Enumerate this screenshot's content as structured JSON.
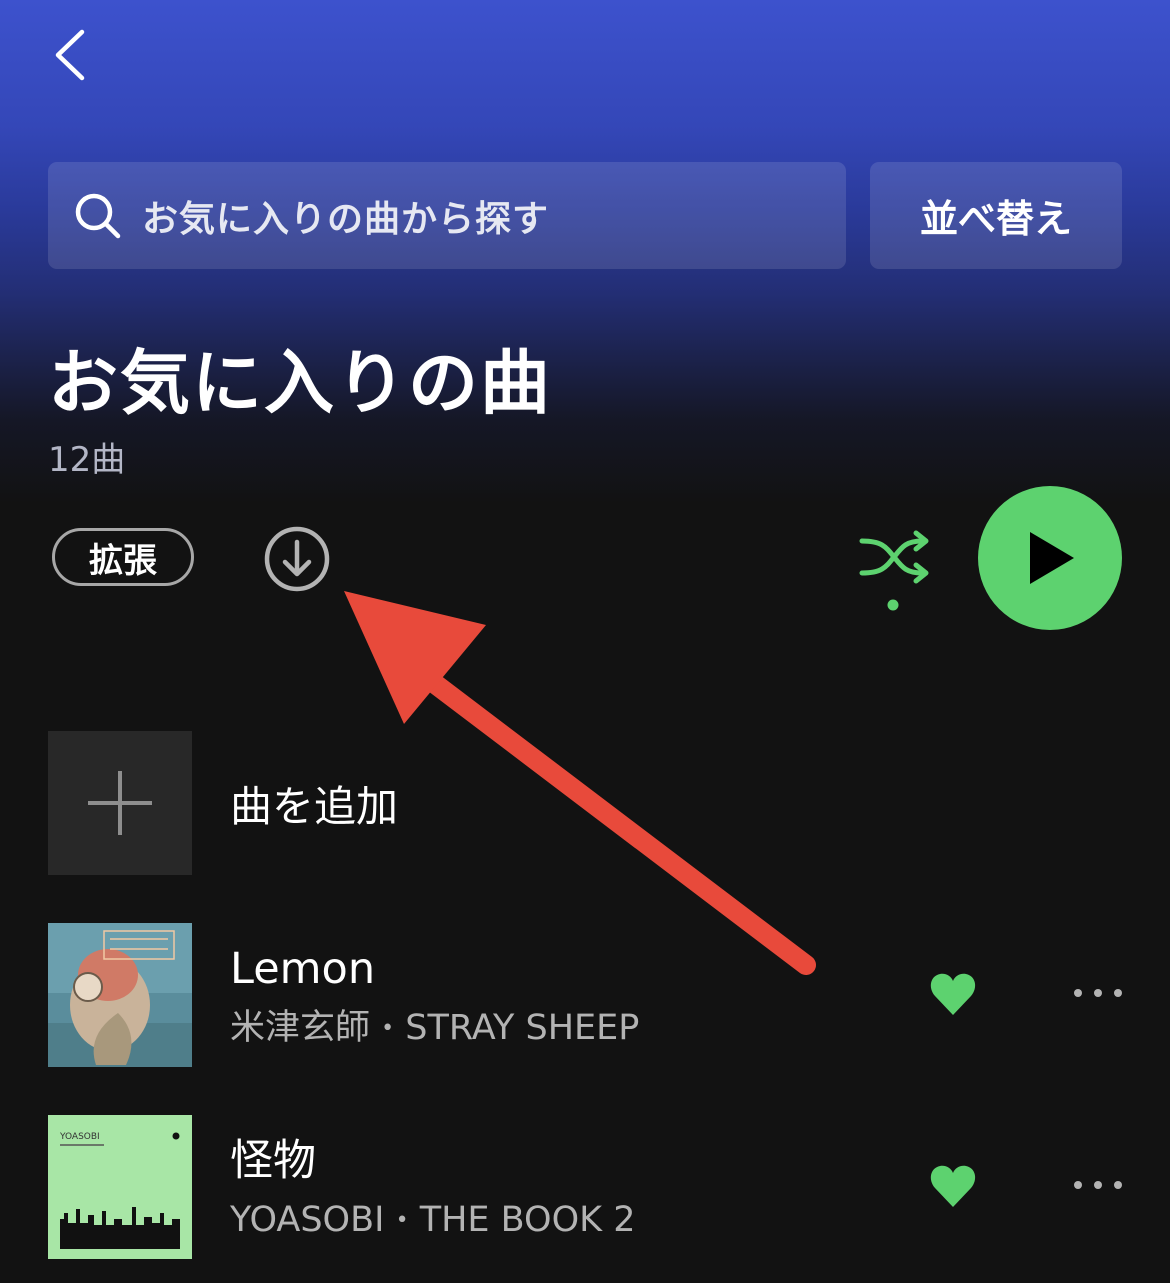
{
  "header": {
    "search_placeholder": "お気に入りの曲から探す",
    "sort_label": "並べ替え"
  },
  "playlist": {
    "title": "お気に入りの曲",
    "count": "12曲",
    "expand_label": "拡張"
  },
  "colors": {
    "accent_green": "#5dd26f",
    "annotation_arrow": "#e84a3b",
    "gradient_top": "#3d52cd"
  },
  "add_song": {
    "label": "曲を追加"
  },
  "tracks": [
    {
      "title": "Lemon",
      "artist": "米津玄師",
      "separator": "•",
      "album": "STRAY SHEEP",
      "liked": true
    },
    {
      "title": "怪物",
      "artist": "YOASOBI",
      "separator": "•",
      "album": "THE BOOK 2",
      "album_art_text": "YOASOBI",
      "liked": true
    }
  ]
}
